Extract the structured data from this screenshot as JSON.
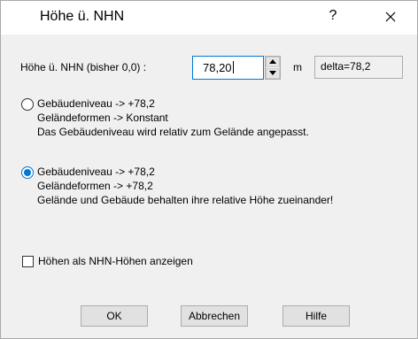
{
  "window": {
    "title": "Höhe ü. NHN",
    "help_glyph": "?",
    "close_icon": "close-icon"
  },
  "height_row": {
    "label": "Höhe ü. NHN (bisher 0,0) :",
    "value": "78,20",
    "unit": "m",
    "delta": "delta=78,2"
  },
  "options": [
    {
      "selected": false,
      "lines": [
        "Gebäudeniveau -> +78,2",
        "Geländeformen -> Konstant",
        "Das Gebäudeniveau wird relativ zum Gelände angepasst."
      ]
    },
    {
      "selected": true,
      "lines": [
        "Gebäudeniveau -> +78,2",
        "Geländeformen -> +78,2",
        "Gelände und Gebäude behalten ihre relative Höhe zueinander!"
      ]
    }
  ],
  "checkbox": {
    "label": "Höhen als NHN-Höhen anzeigen",
    "checked": false
  },
  "buttons": {
    "ok": "OK",
    "cancel": "Abbrechen",
    "help": "Hilfe"
  },
  "colors": {
    "accent": "#0078d7",
    "dialog_bg": "#f0f0f0",
    "button_bg": "#e1e1e1"
  }
}
